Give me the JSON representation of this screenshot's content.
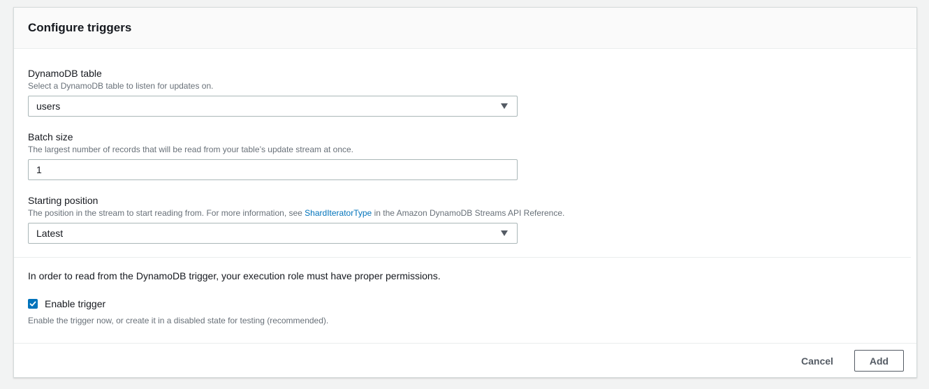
{
  "panel": {
    "title": "Configure triggers"
  },
  "dynamodb_table": {
    "label": "DynamoDB table",
    "description": "Select a DynamoDB table to listen for updates on.",
    "value": "users"
  },
  "batch_size": {
    "label": "Batch size",
    "description": "The largest number of records that will be read from your table’s update stream at once.",
    "value": "1"
  },
  "starting_position": {
    "label": "Starting position",
    "description_prefix": "The position in the stream to start reading from. For more information, see ",
    "description_link": "ShardIteratorType",
    "description_suffix": " in the Amazon DynamoDB Streams API Reference.",
    "value": "Latest"
  },
  "permissions_note": "In order to read from the DynamoDB trigger, your execution role must have proper permissions.",
  "enable_trigger": {
    "label": "Enable trigger",
    "checked": true,
    "description": "Enable the trigger now, or create it in a disabled state for testing (recommended)."
  },
  "footer": {
    "cancel_label": "Cancel",
    "add_label": "Add"
  },
  "colors": {
    "accent": "#0073bb",
    "link": "#0073bb",
    "border": "#aab7b8"
  },
  "icons": {
    "dropdown": "caret-down-icon",
    "checkbox": "checkmark-icon"
  }
}
